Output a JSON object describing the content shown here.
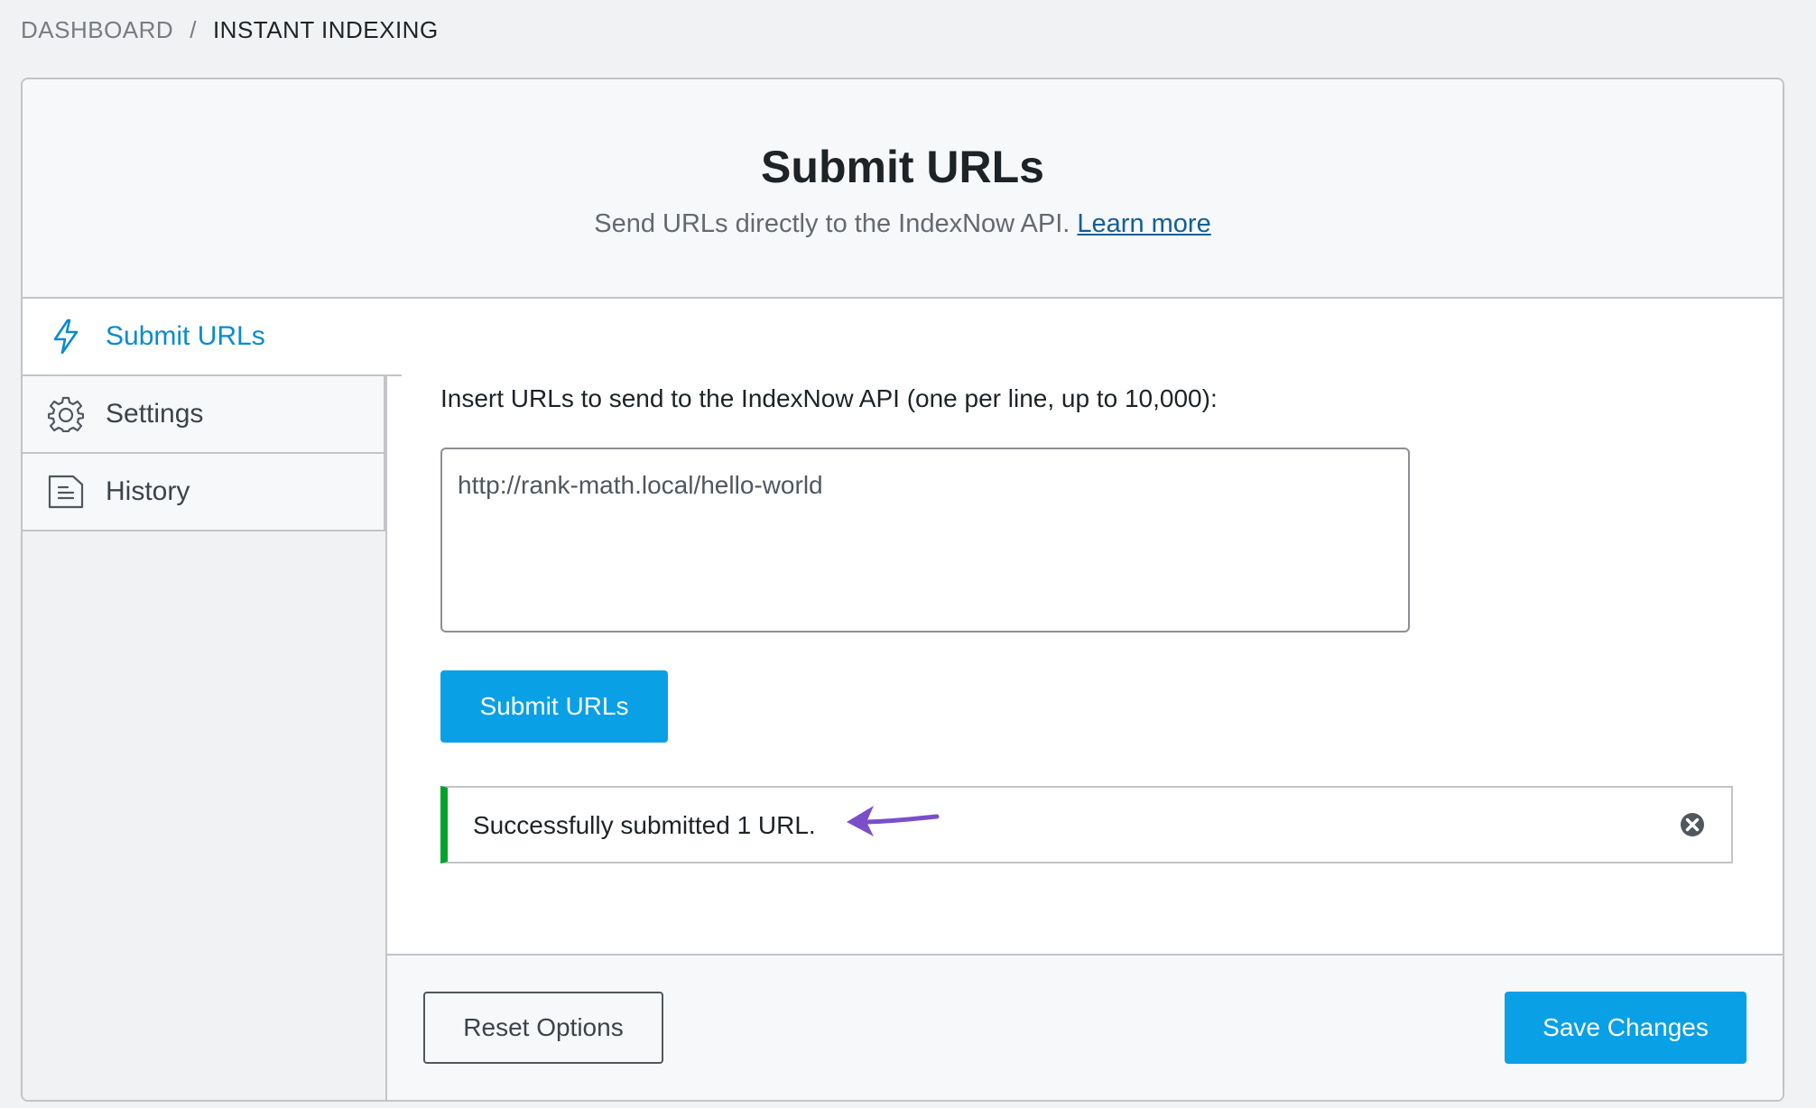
{
  "breadcrumb": {
    "parent": "DASHBOARD",
    "separator": "/",
    "current": "INSTANT INDEXING"
  },
  "header": {
    "title": "Submit URLs",
    "subtitle": "Send URLs directly to the IndexNow API.",
    "learn_more": "Learn more"
  },
  "tabs": [
    {
      "label": "Submit URLs",
      "icon": "lightning-icon",
      "active": true
    },
    {
      "label": "Settings",
      "icon": "gear-icon",
      "active": false
    },
    {
      "label": "History",
      "icon": "document-icon",
      "active": false
    }
  ],
  "form": {
    "label": "Insert URLs to send to the IndexNow API (one per line, up to 10,000):",
    "textarea_value": "http://rank-math.local/hello-world",
    "submit_label": "Submit URLs"
  },
  "notice": {
    "text": "Successfully submitted 1 URL.",
    "status_color": "#00a32a"
  },
  "footer": {
    "reset_label": "Reset Options",
    "save_label": "Save Changes"
  },
  "colors": {
    "accent": "#0aa0e6",
    "active_tab_text": "#0a8bd0",
    "annotation_arrow": "#7b4fc9"
  }
}
